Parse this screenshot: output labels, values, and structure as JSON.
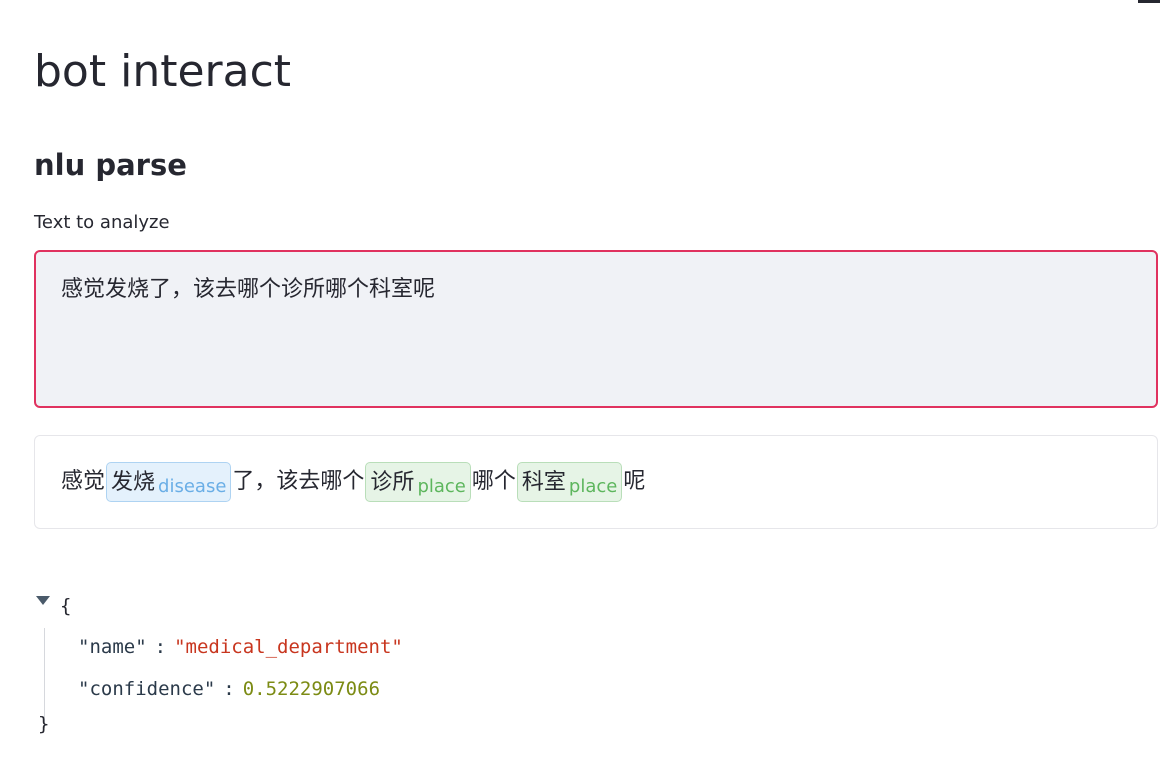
{
  "page": {
    "title": "bot interact",
    "subtitle": "nlu parse"
  },
  "input": {
    "label": "Text to analyze",
    "value": "感觉发烧了，该去哪个诊所哪个科室呢",
    "focus_border_color": "#e0325f"
  },
  "ner": {
    "segments": [
      {
        "text": "感觉"
      },
      {
        "text": "发烧",
        "label": "disease"
      },
      {
        "text": "了，该去哪个"
      },
      {
        "text": "诊所",
        "label": "place"
      },
      {
        "text": "哪个"
      },
      {
        "text": "科室",
        "label": "place"
      },
      {
        "text": "呢"
      }
    ],
    "colors": {
      "disease": "#6aaee6",
      "place": "#5db65d"
    }
  },
  "json_view": {
    "open_brace": "{",
    "close_brace": "}",
    "rows": [
      {
        "key": "\"name\"",
        "colon": ":",
        "value": "\"medical_department\""
      },
      {
        "key": "\"confidence\"",
        "colon": ":",
        "value": "0.5222907066"
      }
    ]
  }
}
